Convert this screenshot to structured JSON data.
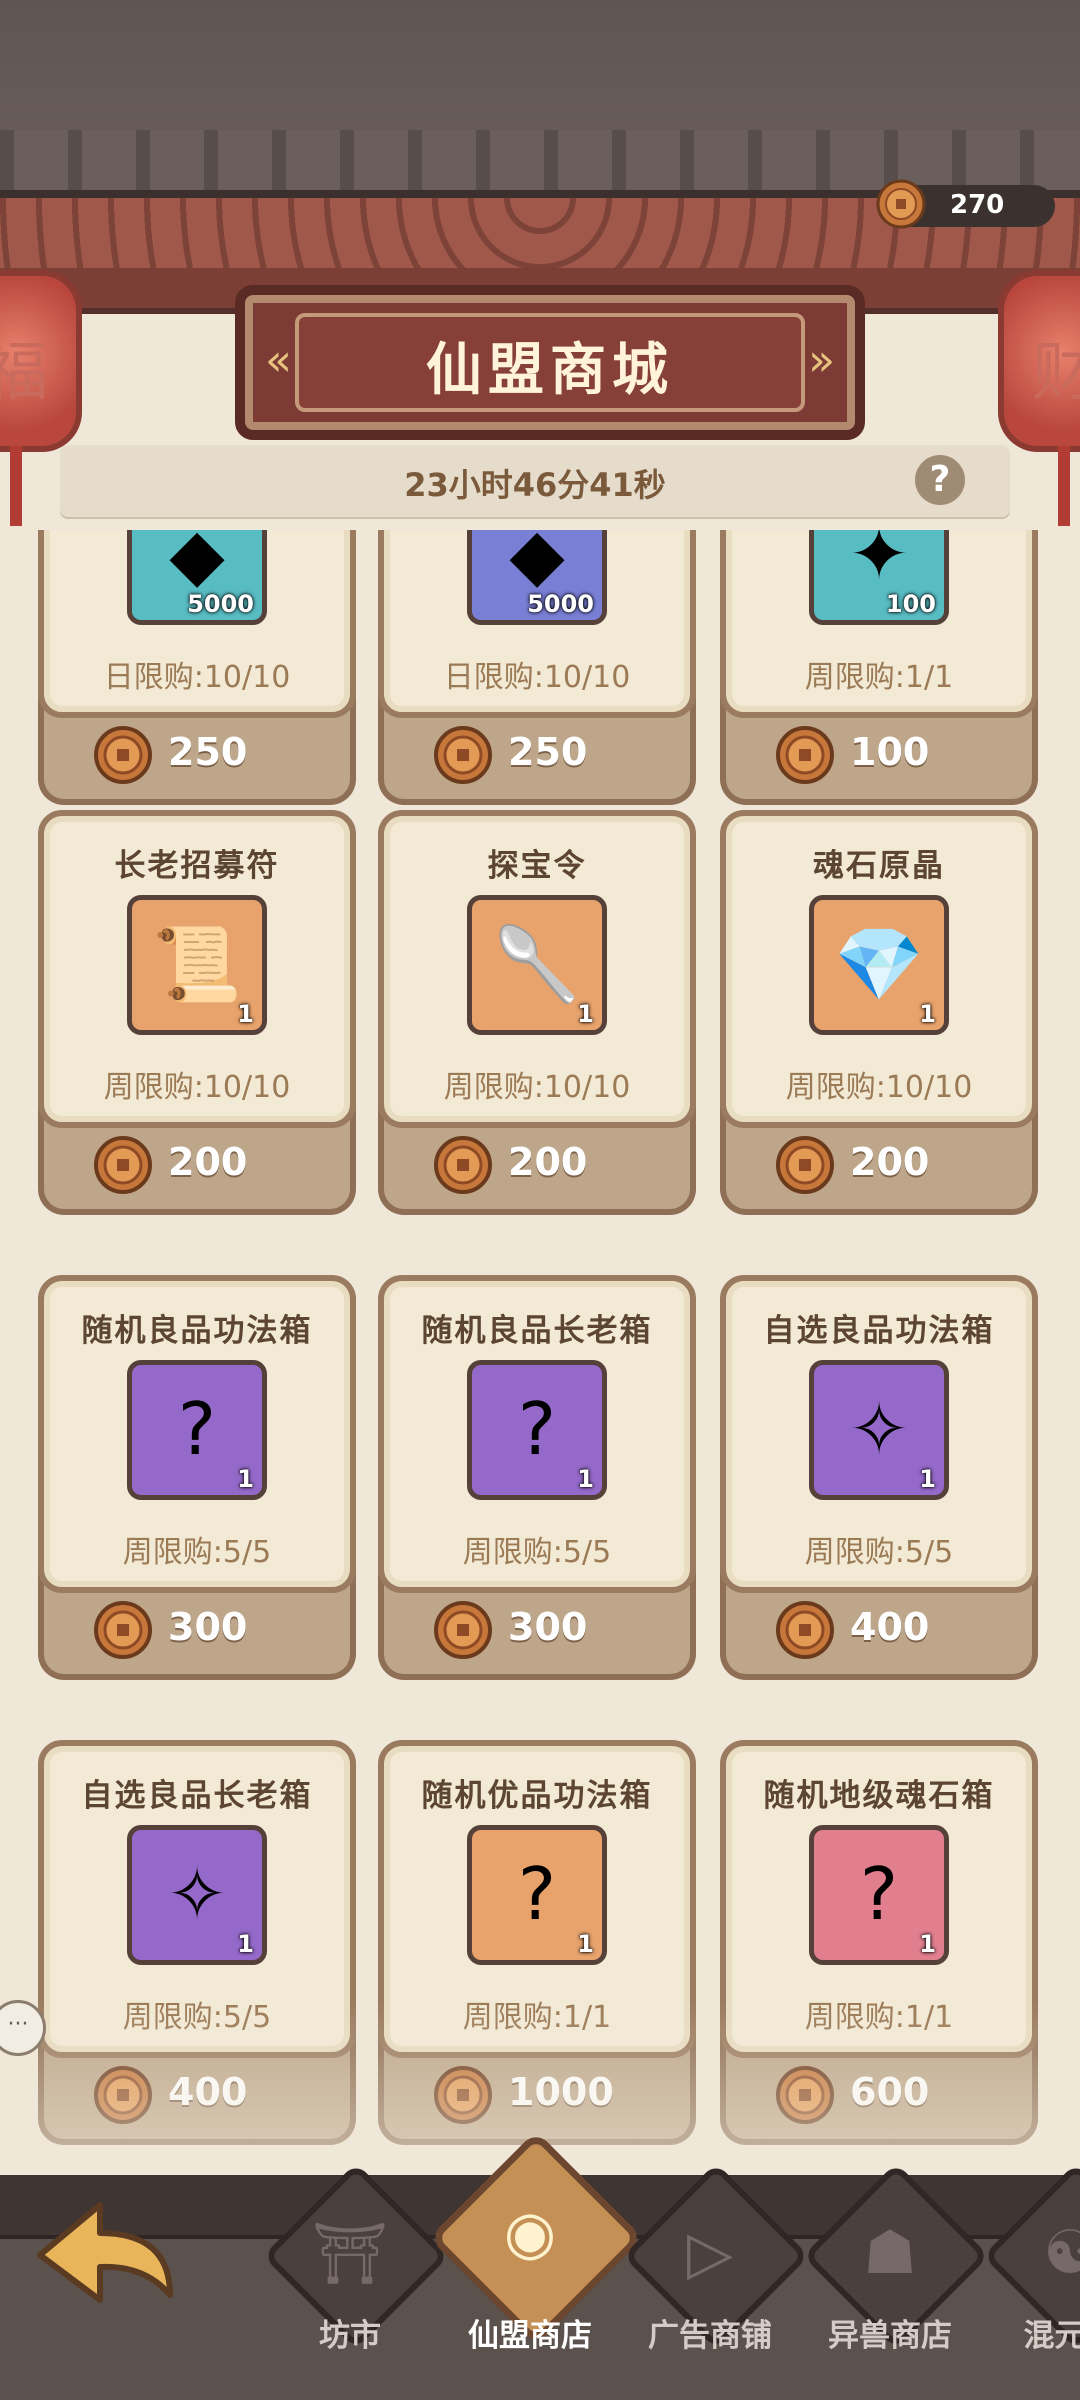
{
  "header": {
    "title": "仙盟商城",
    "coins": "270",
    "timer": "23小时46分41秒",
    "help_glyph": "?",
    "lantern_left": "福",
    "lantern_right": "财"
  },
  "rows": [
    [
      {
        "name": "",
        "limit": "日限购:10/10",
        "price": "250",
        "qty": "5000",
        "bg": "#58bcc3",
        "glyph": "◆"
      },
      {
        "name": "",
        "limit": "日限购:10/10",
        "price": "250",
        "qty": "5000",
        "bg": "#7a7fd6",
        "glyph": "◆"
      },
      {
        "name": "",
        "limit": "周限购:1/1",
        "price": "100",
        "qty": "100",
        "bg": "#58bcc3",
        "glyph": "✦"
      }
    ],
    [
      {
        "name": "长老招募符",
        "limit": "周限购:10/10",
        "price": "200",
        "qty": "1",
        "bg": "#e8a36c",
        "glyph": "📜"
      },
      {
        "name": "探宝令",
        "limit": "周限购:10/10",
        "price": "200",
        "qty": "1",
        "bg": "#e8a36c",
        "glyph": "🥄"
      },
      {
        "name": "魂石原晶",
        "limit": "周限购:10/10",
        "price": "200",
        "qty": "1",
        "bg": "#e8a36c",
        "glyph": "💎"
      }
    ],
    [
      {
        "name": "随机良品功法箱",
        "limit": "周限购:5/5",
        "price": "300",
        "qty": "1",
        "bg": "#9569c9",
        "glyph": "?"
      },
      {
        "name": "随机良品长老箱",
        "limit": "周限购:5/5",
        "price": "300",
        "qty": "1",
        "bg": "#9569c9",
        "glyph": "?"
      },
      {
        "name": "自选良品功法箱",
        "limit": "周限购:5/5",
        "price": "400",
        "qty": "1",
        "bg": "#9569c9",
        "glyph": "✧"
      }
    ],
    [
      {
        "name": "自选良品长老箱",
        "limit": "周限购:5/5",
        "price": "400",
        "qty": "1",
        "bg": "#9569c9",
        "glyph": "✧"
      },
      {
        "name": "随机优品功法箱",
        "limit": "周限购:1/1",
        "price": "1000",
        "qty": "1",
        "bg": "#e8a36c",
        "glyph": "?"
      },
      {
        "name": "随机地级魂石箱",
        "limit": "周限购:1/1",
        "price": "600",
        "qty": "1",
        "bg": "#e17f8f",
        "glyph": "?"
      }
    ]
  ],
  "nav": {
    "tabs": [
      {
        "label": "坊市",
        "glyph": "⛩",
        "icon": "market-icon"
      },
      {
        "label": "仙盟商店",
        "glyph": "◉",
        "icon": "alliance-shop-icon",
        "active": true
      },
      {
        "label": "广告商铺",
        "glyph": "▷",
        "icon": "ad-shop-icon"
      },
      {
        "label": "异兽商店",
        "glyph": "☗",
        "icon": "beast-shop-icon"
      },
      {
        "label": "混元商",
        "glyph": "☯",
        "icon": "hunyuan-shop-icon"
      }
    ]
  },
  "colors": {
    "coin": "#c7773a",
    "coin_rim": "#8d4a24"
  }
}
